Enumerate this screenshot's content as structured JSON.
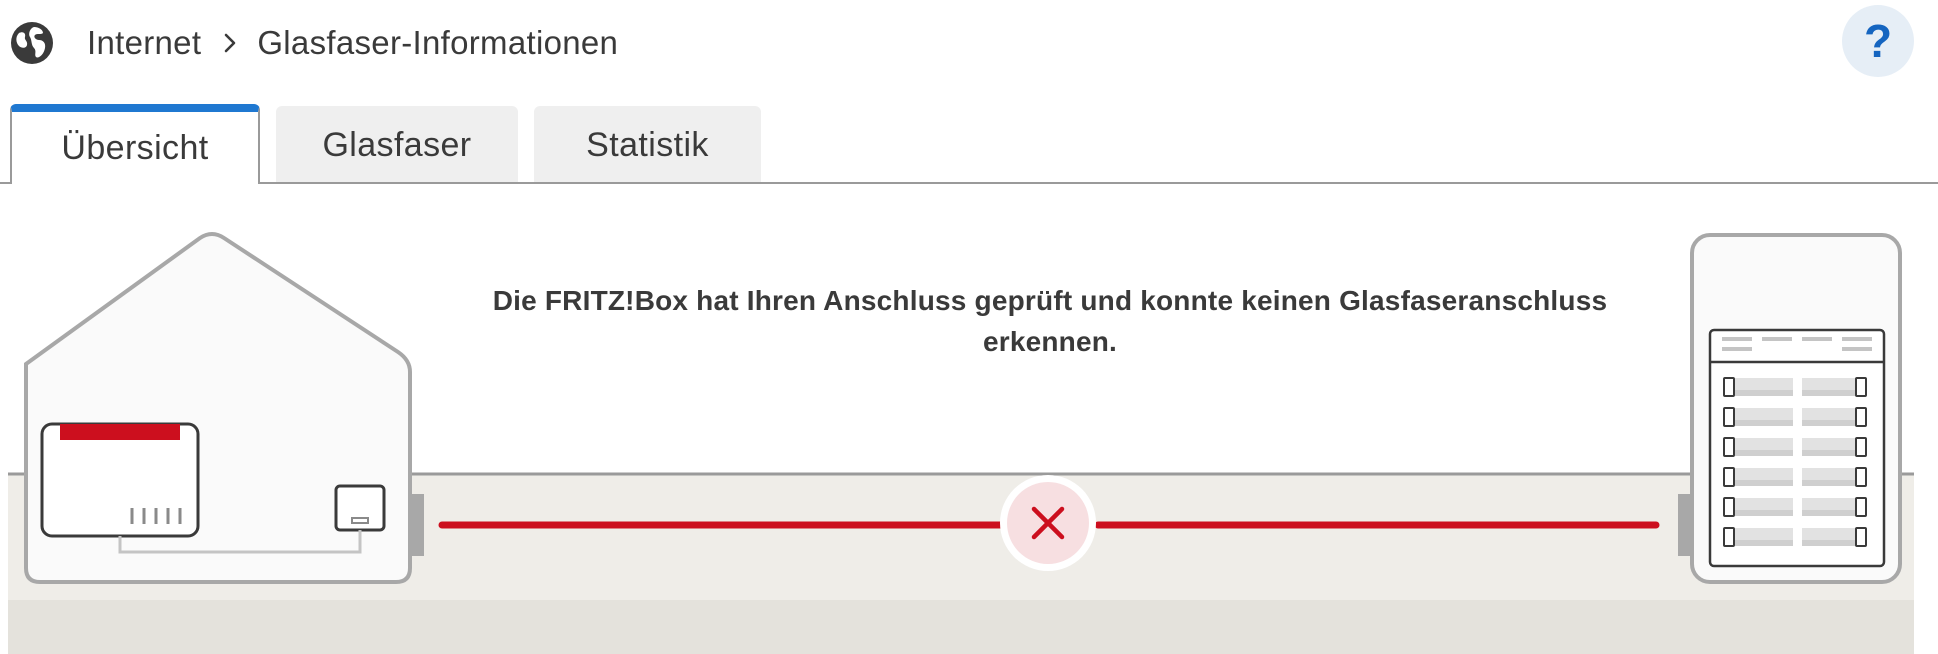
{
  "breadcrumb": {
    "icon": "globe-icon",
    "items": [
      "Internet",
      "Glasfaser-Informationen"
    ],
    "separator_icon": "chevron-right-icon"
  },
  "help": {
    "label": "?",
    "icon": "help-icon"
  },
  "tabs": [
    {
      "label": "Übersicht",
      "active": true
    },
    {
      "label": "Glasfaser",
      "active": false
    },
    {
      "label": "Statistik",
      "active": false
    }
  ],
  "status": {
    "message": "Die FRITZ!Box hat Ihren Anschluss geprüft und konnte keinen Glasfaseranschluss erkennen.",
    "connection_state": "error",
    "error_icon": "x-mark-icon"
  },
  "colors": {
    "accent": "#1f78d1",
    "error": "#cc0f1e",
    "error_bg": "#f7dfe1",
    "ground": "#efede8"
  }
}
